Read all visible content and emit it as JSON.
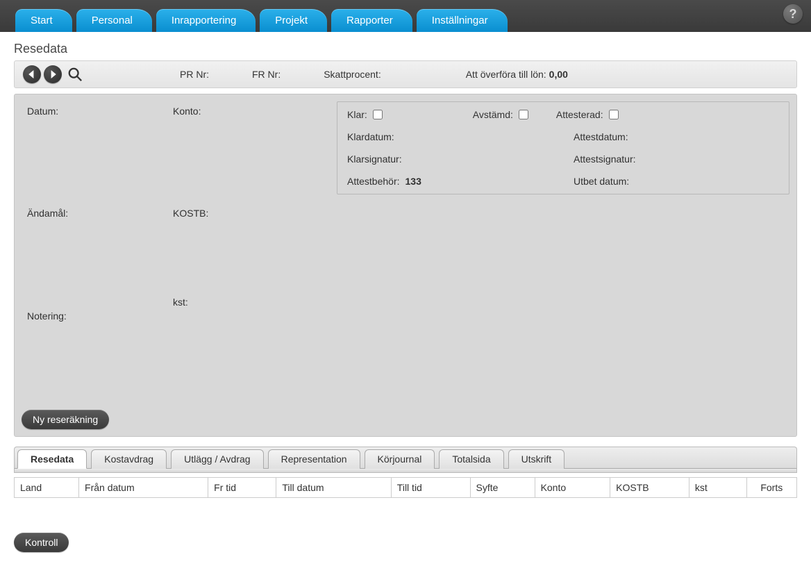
{
  "nav": {
    "items": [
      {
        "label": "Start"
      },
      {
        "label": "Personal"
      },
      {
        "label": "Inrapportering"
      },
      {
        "label": "Projekt"
      },
      {
        "label": "Rapporter"
      },
      {
        "label": "Inställningar"
      }
    ],
    "help_glyph": "?"
  },
  "page_title": "Resedata",
  "toolbar": {
    "pr_nr_label": "PR Nr:",
    "pr_nr_value": "",
    "fr_nr_label": "FR Nr:",
    "fr_nr_value": "",
    "skatt_label": "Skattprocent:",
    "skatt_value": "",
    "transfer_label": "Att överföra till lön:",
    "transfer_value": "0,00"
  },
  "left_panel": {
    "datum_label": "Datum:",
    "konto_label": "Konto:",
    "andamal_label": "Ändamål:",
    "kostb_label": "KOSTB:",
    "notering_label": "Notering:",
    "kst_label": "kst:"
  },
  "right_panel": {
    "klar_label": "Klar:",
    "avstamd_label": "Avstämd:",
    "attesterad_label": "Attesterad:",
    "klardatum_label": "Klardatum:",
    "attestdatum_label": "Attestdatum:",
    "klarsignatur_label": "Klarsignatur:",
    "attestsignatur_label": "Attestsignatur:",
    "attestbehor_label": "Attestbehör:",
    "attestbehor_value": "133",
    "utbet_label": "Utbet datum:"
  },
  "buttons": {
    "ny_reserakning": "Ny reseräkning",
    "kontroll": "Kontroll"
  },
  "subtabs": [
    {
      "label": "Resedata",
      "active": true
    },
    {
      "label": "Kostavdrag"
    },
    {
      "label": "Utlägg / Avdrag"
    },
    {
      "label": "Representation"
    },
    {
      "label": "Körjournal"
    },
    {
      "label": "Totalsida"
    },
    {
      "label": "Utskrift"
    }
  ],
  "table": {
    "columns": [
      "Land",
      "Från datum",
      "Fr tid",
      "Till datum",
      "Till tid",
      "Syfte",
      "Konto",
      "KOSTB",
      "kst",
      "Forts"
    ]
  }
}
